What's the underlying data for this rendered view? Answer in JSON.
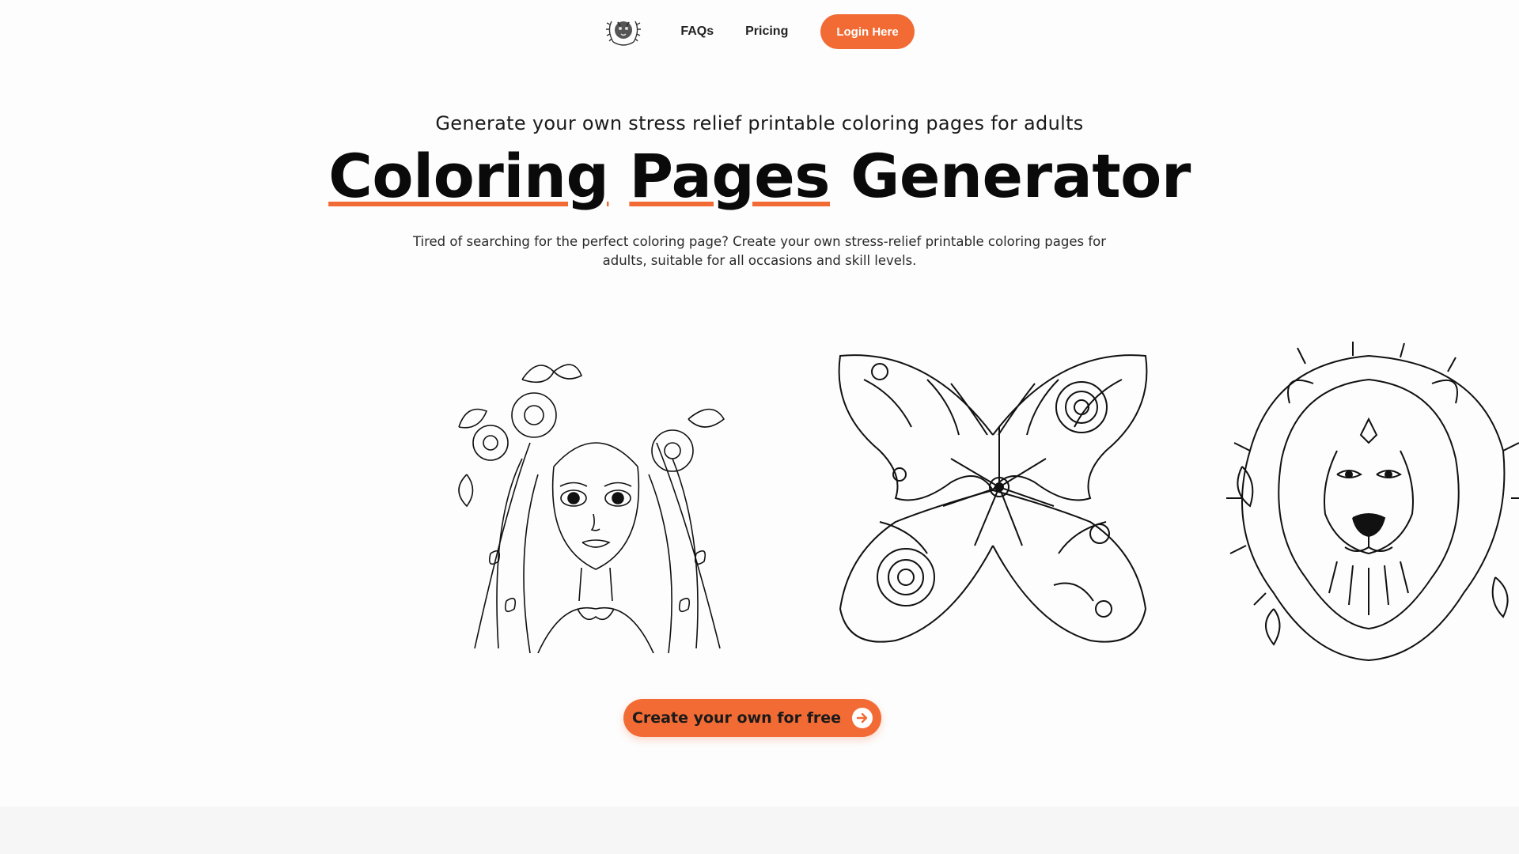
{
  "nav": {
    "logo_icon": "laurel-animal-logo-icon",
    "links": [
      {
        "label": "FAQs"
      },
      {
        "label": "Pricing"
      }
    ],
    "login_label": "Login Here"
  },
  "hero": {
    "subtitle": "Generate your own stress relief printable coloring pages for adults",
    "title_part1": "Coloring",
    "title_part2": "Pages",
    "title_part3": "Generator",
    "description": "Tired of searching for the perfect coloring page? Create your own stress-relief printable coloring pages for adults, suitable for all occasions and skill levels."
  },
  "gallery": {
    "images": [
      {
        "icon": "girl-with-flowers-illustration"
      },
      {
        "icon": "mandala-butterfly-illustration"
      },
      {
        "icon": "lion-head-illustration"
      }
    ]
  },
  "cta": {
    "label": "Create your own for free",
    "icon": "arrow-right-circle-icon"
  },
  "colors": {
    "accent": "#f26b35",
    "background": "#fdfdfd",
    "text": "#111111"
  }
}
